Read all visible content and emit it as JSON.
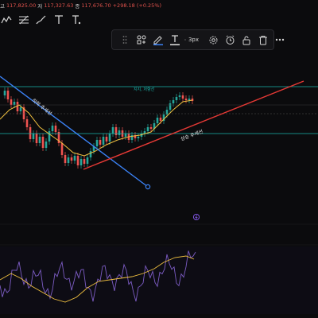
{
  "header": {
    "ohlc": [
      {
        "label": "고",
        "value": "117,825.00"
      },
      {
        "label": "저",
        "value": "117,327.63"
      },
      {
        "label": "종",
        "value": "117,676.70"
      },
      {
        "label": "",
        "value": "+298.18 (+0.25%)"
      }
    ]
  },
  "draw_tools": [
    {
      "name": "trendline-tool-icon",
      "icon": "zigzag"
    },
    {
      "name": "fib-tool-icon",
      "icon": "fib"
    },
    {
      "name": "brush-tool-icon",
      "icon": "brush"
    },
    {
      "name": "text-tool-icon",
      "icon": "T"
    },
    {
      "name": "text-tool-alt-icon",
      "icon": "T"
    }
  ],
  "toolbar": {
    "line_width_label": "3px",
    "line_color": "#3b82f6"
  },
  "annotations": {
    "downtrend_label": "하락 추세선",
    "uptrend_label": "상승 추세선",
    "resistance_label": "지지, 저항선"
  },
  "colors": {
    "up_candle": "#26a69a",
    "down_candle": "#ef5350",
    "downtrend_line": "#3b82f6",
    "uptrend_line": "#e53935",
    "hline": "#19b5ad",
    "ma": "#f0c040",
    "rsi": "#7c5cc4"
  }
}
